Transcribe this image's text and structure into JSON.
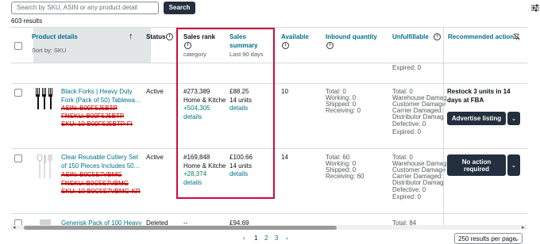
{
  "search": {
    "placeholder": "Search by SKU, ASIN or any product detail",
    "button": "Search"
  },
  "results_count": "603 results",
  "columns": {
    "product_details": "Product details",
    "sort_by": "Sort by: SKU",
    "status": "Status",
    "sales_rank": "Sales rank",
    "sales_rank_sub": "category",
    "sales_summary_1": "Sales",
    "sales_summary_2": "summary",
    "sales_summary_sub": "Last 90 days",
    "available": "Available",
    "inbound": "Inbound quantity",
    "unfulfillable": "Unfulfillable",
    "recommended": "Recommended action"
  },
  "partial_row": {
    "expired": "Expired: 0"
  },
  "rows": [
    {
      "title1": "Black Forks | Heavy Duty",
      "title2": "Fork (Pack of 50) Tablewa...",
      "struck1": "ASIN: B09F5J5BTP",
      "struck2": "FNSKU: B09F5J5BTP",
      "struck3": "SKU: 10-B09F5J5BTP-FI",
      "status": "Active",
      "rank": "#273,389",
      "rank_cat": "Home & Kitche",
      "rank_change": "+504,305",
      "rank_details": "details",
      "sales_amount": "£88.25",
      "sales_units": "14 units",
      "sales_details": "details",
      "available": "10",
      "inbound": [
        "Total: 0",
        "Working: 0",
        "Shipped: 0",
        "Receiving: 0"
      ],
      "unfulfillable": [
        "Total: 0",
        "Warehouse Damag",
        "Customer Damage",
        "Carrier Damaged:",
        "Distributor Damag",
        "Defective: 0",
        "Expired: 0"
      ],
      "recommended_text": "Restock 3 units in 14 days at FBA",
      "button": "Advertise listing"
    },
    {
      "title1": "Clear Reusable Cutlery Set",
      "title2": "of 150 Pieces Includes 50...",
      "struck1": "ASIN: B0C5S7VBMG",
      "struck2": "FNSKU: B0C5S7VBMG",
      "struck3": "SKU: 10-B0C5S7VBMG-KR",
      "status": "Active",
      "rank": "#169,848",
      "rank_cat": "Home & Kitche",
      "rank_change": "+28,374",
      "rank_details": "details",
      "sales_amount": "£100.66",
      "sales_units": "14 units",
      "sales_details": "details",
      "available": "14",
      "inbound": [
        "Total: 60",
        "Working: 0",
        "Shipped: 0",
        "Receiving: 60"
      ],
      "unfulfillable": [
        "Total: 0",
        "Warehouse Damag",
        "Customer Damage",
        "Carrier Damaged:",
        "Distributor Damag",
        "Defective: 0",
        "Expired: 0"
      ],
      "button_line1": "No action",
      "button_line2": "required"
    },
    {
      "title1": "Generisk Pack of 100 Heavy",
      "status": "Deleted",
      "rank": "--",
      "sales_amount": "£94.69",
      "unfulfillable_total": "Total: 84"
    }
  ],
  "pagination": {
    "prev": "‹",
    "pages": [
      "1",
      "2",
      "3"
    ],
    "next": "›",
    "per_page": "250 results per page"
  }
}
